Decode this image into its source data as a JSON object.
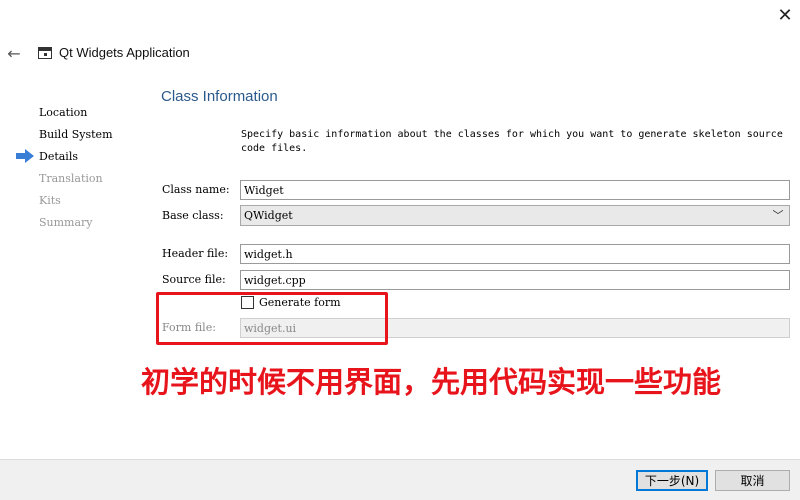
{
  "window": {
    "close_glyph": "✕"
  },
  "header": {
    "back_icon": "arrow-left-icon",
    "app_icon": "window-icon",
    "title": "Qt Widgets Application"
  },
  "steps": [
    {
      "label": "Location",
      "state": "done"
    },
    {
      "label": "Build System",
      "state": "done"
    },
    {
      "label": "Details",
      "state": "current"
    },
    {
      "label": "Translation",
      "state": "pending"
    },
    {
      "label": "Kits",
      "state": "pending"
    },
    {
      "label": "Summary",
      "state": "pending"
    }
  ],
  "main": {
    "title": "Class Information",
    "description": "Specify basic information about the classes for which you want to generate skeleton source code files.",
    "class_name": {
      "label": "Class name:",
      "value": "Widget"
    },
    "base_class": {
      "label": "Base class:",
      "value": "QWidget"
    },
    "header_file": {
      "label": "Header file:",
      "value": "widget.h"
    },
    "source_file": {
      "label": "Source file:",
      "value": "widget.cpp"
    },
    "generate_form": {
      "label": "Generate form",
      "checked": false
    },
    "form_file": {
      "label": "Form file:",
      "value": "widget.ui"
    }
  },
  "annotation": {
    "text": "初学的时候不用界面，先用代码实现一些功能",
    "color": "#e8141c"
  },
  "footer": {
    "next_label": "下一步(N)",
    "cancel_label": "取消"
  },
  "colors": {
    "accent": "#2a5a8c",
    "focus": "#0078d7",
    "annotation": "#e8141c"
  }
}
